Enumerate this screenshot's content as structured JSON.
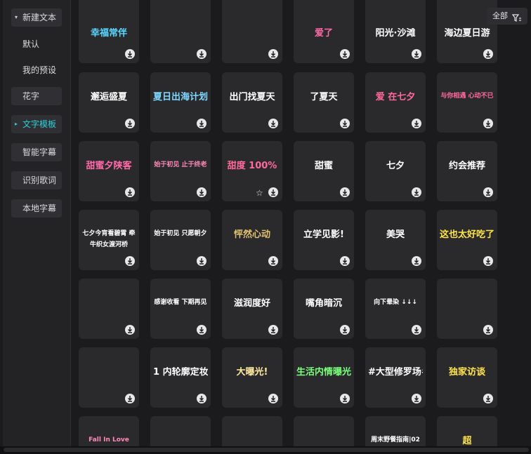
{
  "sidebar": {
    "items": [
      {
        "label": "新建文本",
        "style": "boxed",
        "caret": "▾",
        "active": false
      },
      {
        "label": "默认",
        "style": "plain",
        "caret": "",
        "active": false
      },
      {
        "label": "我的预设",
        "style": "plain",
        "caret": "",
        "active": false
      },
      {
        "label": "花字",
        "style": "boxed",
        "caret": "",
        "active": false
      },
      {
        "label": "文字模板",
        "style": "boxed",
        "caret": "▸",
        "active": true
      },
      {
        "label": "智能字幕",
        "style": "boxed",
        "caret": "",
        "active": false
      },
      {
        "label": "识别歌词",
        "style": "boxed",
        "caret": "",
        "active": false
      },
      {
        "label": "本地字幕",
        "style": "boxed",
        "caret": "",
        "active": false
      }
    ]
  },
  "filter": {
    "label": "全部",
    "icon": "filter-icon"
  },
  "colors": {
    "accent": "#2bd1d9",
    "card_bg": "#2a2a2d",
    "panel_bg": "#232326"
  },
  "templates": [
    {
      "title": "幸福常伴",
      "color": "#5ad7ff"
    },
    {
      "title": "",
      "color": "#e0c070"
    },
    {
      "title": "",
      "color": "#ffd84a"
    },
    {
      "title": "爱了",
      "color": "#ff6aa8"
    },
    {
      "title": "阳光·沙滩",
      "color": "#ffffff"
    },
    {
      "title": "海边夏日游",
      "color": "#ffffff"
    },
    {
      "title": "邂逅盛夏",
      "color": "#ffffff"
    },
    {
      "title": "夏日出海计划",
      "color": "#7fd8ff"
    },
    {
      "title": "出门找夏天",
      "color": "#ffffff"
    },
    {
      "title": "了夏天",
      "color": "#ffffff"
    },
    {
      "title": "爱 在七夕",
      "color": "#ff6a9a"
    },
    {
      "title": "与你相遇 心动不已",
      "color": "#ff6a9a"
    },
    {
      "title": "甜蜜夕陕客",
      "color": "#ff6aa8"
    },
    {
      "title": "始于初见 止于终老",
      "color": "#ff8ab8"
    },
    {
      "title": "甜度 100%",
      "color": "#ff6a9a",
      "fav": true
    },
    {
      "title": "甜蜜",
      "color": "#ffffff"
    },
    {
      "title": "七夕",
      "color": "#ffffff"
    },
    {
      "title": "约会推荐",
      "color": "#ffffff"
    },
    {
      "title": "七夕今宵看碧霄 牵牛织女渡河桥",
      "color": "#ffffff"
    },
    {
      "title": "始于初见 只愿朝夕",
      "color": "#ffffff"
    },
    {
      "title": "怦然心动",
      "color": "#e0c070"
    },
    {
      "title": "立学见影!",
      "color": "#ffffff"
    },
    {
      "title": "美哭",
      "color": "#ffffff"
    },
    {
      "title": "这也太好吃了~",
      "color": "#ffe44a"
    },
    {
      "title": "",
      "color": "#ff6a9a"
    },
    {
      "title": "感谢收看 下期再见",
      "color": "#ffffff"
    },
    {
      "title": "滋润度好",
      "color": "#ffffff"
    },
    {
      "title": "嘴角暗沉",
      "color": "#ffffff"
    },
    {
      "title": "向下晕染 ↓↓↓",
      "color": "#ffffff"
    },
    {
      "title": "",
      "color": "#ff6a9a"
    },
    {
      "title": "",
      "color": "#cfcfcf"
    },
    {
      "title": "1 内轮廓定妆",
      "color": "#ffffff"
    },
    {
      "title": "大曝光!",
      "color": "#ffe8a0"
    },
    {
      "title": "生活内情曝光!",
      "color": "#7aff7a"
    },
    {
      "title": "#大型修罗场#",
      "color": "#ffffff"
    },
    {
      "title": "独家访谈",
      "color": "#ffe44a"
    },
    {
      "title": "Fall In Love",
      "color": "#ff8ab8"
    },
    {
      "title": "",
      "color": "#ffffff"
    },
    {
      "title": "",
      "color": "#ffffff"
    },
    {
      "title": "",
      "color": "#cfcfcf"
    },
    {
      "title": "周末野餐指南|02",
      "color": "#ffffff"
    },
    {
      "title": "超",
      "color": "#ffe44a"
    }
  ]
}
